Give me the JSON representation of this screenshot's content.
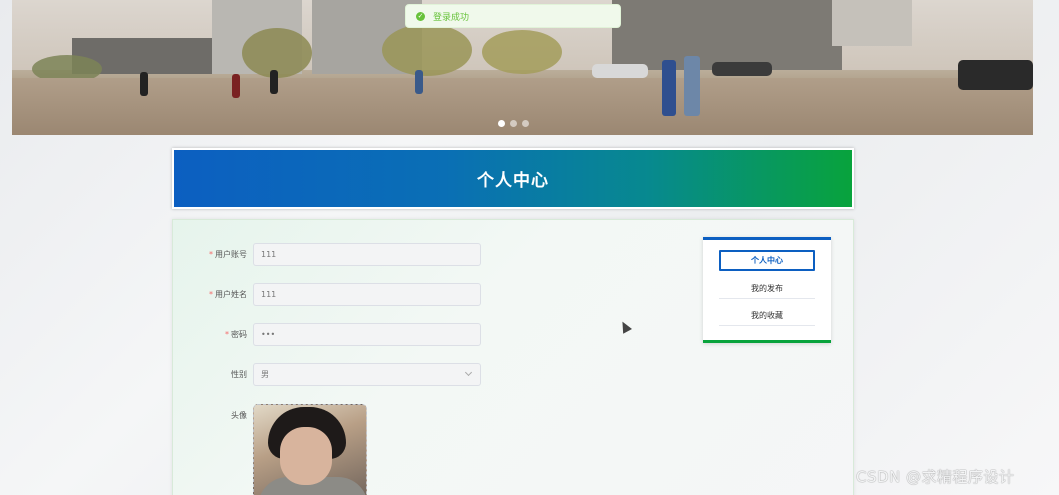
{
  "toast": {
    "message": "登录成功"
  },
  "banner": {
    "slide_count": 3,
    "active_slide": 1
  },
  "page": {
    "title": "个人中心"
  },
  "form": {
    "account": {
      "label": "用户账号",
      "required": true,
      "value": "111"
    },
    "name": {
      "label": "用户姓名",
      "required": true,
      "value": "111"
    },
    "password": {
      "label": "密码",
      "required": true,
      "value": "•••"
    },
    "gender": {
      "label": "性别",
      "required": false,
      "value": "男"
    },
    "avatar": {
      "label": "头像"
    }
  },
  "side_menu": {
    "items": [
      {
        "label": "个人中心",
        "active": true
      },
      {
        "label": "我的发布",
        "active": false
      },
      {
        "label": "我的收藏",
        "active": false
      }
    ]
  },
  "watermark": "CSDN @求精程序设计",
  "colors": {
    "primary_blue": "#0c5fc1",
    "primary_green": "#08a33c",
    "success": "#67c23a",
    "required": "#f56c6c"
  }
}
